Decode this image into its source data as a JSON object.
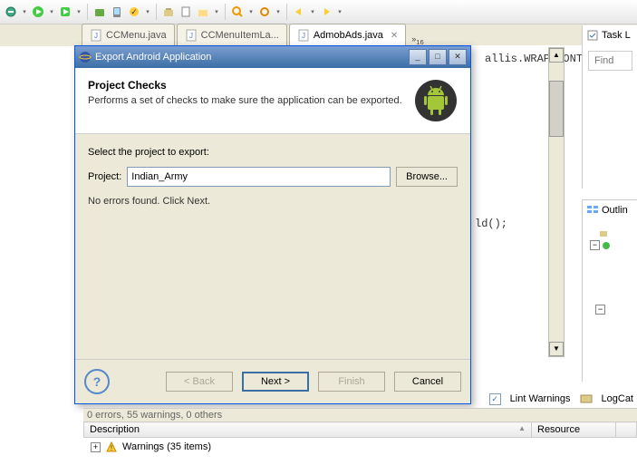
{
  "toolbar": {},
  "tabs": [
    {
      "label": "CCMenu.java",
      "active": false
    },
    {
      "label": "CCMenuItemLa...",
      "active": false
    },
    {
      "label": "AdmobAds.java",
      "active": true
    }
  ],
  "tab_overflow": "16",
  "code_fragment1": "allis.WRAP_CONT",
  "code_fragment2": "ld();",
  "right": {
    "task_list_label": "Task L",
    "find_placeholder": "Find",
    "outline_label": "Outlin"
  },
  "dialog": {
    "title": "Export Android Application",
    "heading": "Project Checks",
    "subheading": "Performs a set of checks to make sure the application can be exported.",
    "select_label": "Select the project to export:",
    "project_label": "Project:",
    "project_value": "Indian_Army",
    "browse_label": "Browse...",
    "status": "No errors found. Click Next.",
    "back_label": "< Back",
    "next_label": "Next >",
    "finish_label": "Finish",
    "cancel_label": "Cancel"
  },
  "problems": {
    "summary": "0 errors, 55 warnings, 0 others",
    "col_description": "Description",
    "col_resource": "Resource",
    "row_label": "Warnings (35 items)",
    "lint_label": "Lint Warnings",
    "logcat_label": "LogCat"
  }
}
